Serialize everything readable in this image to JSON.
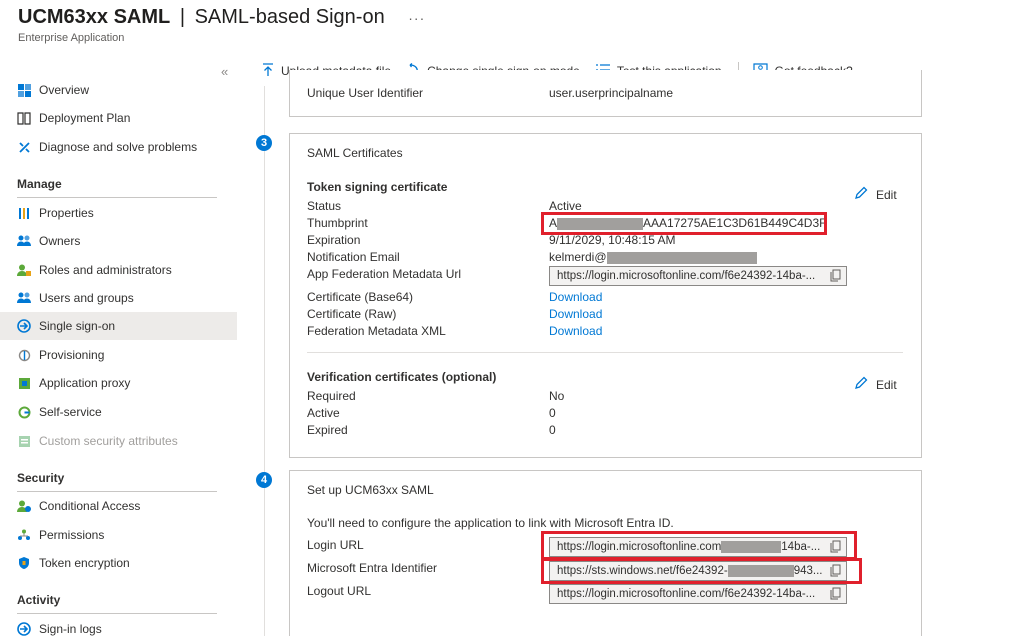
{
  "header": {
    "title_bold": "UCM63xx SAML",
    "title_sep": "|",
    "title_rest": "SAML-based Sign-on",
    "more": "···",
    "subtitle": "Enterprise Application"
  },
  "sidebar": {
    "collapse": "«",
    "items_top": [
      {
        "label": "Overview"
      },
      {
        "label": "Deployment Plan"
      },
      {
        "label": "Diagnose and solve problems"
      }
    ],
    "manage_header": "Manage",
    "manage": [
      {
        "label": "Properties"
      },
      {
        "label": "Owners"
      },
      {
        "label": "Roles and administrators"
      },
      {
        "label": "Users and groups"
      },
      {
        "label": "Single sign-on"
      },
      {
        "label": "Provisioning"
      },
      {
        "label": "Application proxy"
      },
      {
        "label": "Self-service"
      },
      {
        "label": "Custom security attributes"
      }
    ],
    "security_header": "Security",
    "security": [
      {
        "label": "Conditional Access"
      },
      {
        "label": "Permissions"
      },
      {
        "label": "Token encryption"
      }
    ],
    "activity_header": "Activity",
    "activity": [
      {
        "label": "Sign-in logs"
      }
    ]
  },
  "toolbar": {
    "upload": "Upload metadata file",
    "change_mode": "Change single sign-on mode",
    "test": "Test this application",
    "feedback": "Got feedback?"
  },
  "card2": {
    "label": "Unique User Identifier",
    "value": "user.userprincipalname"
  },
  "card3": {
    "step": "3",
    "title": "SAML Certificates",
    "token_header": "Token signing certificate",
    "edit": "Edit",
    "status_label": "Status",
    "status_value": "Active",
    "thumbprint_label": "Thumbprint",
    "thumbprint_prefix": "A",
    "thumbprint_suffix": "AAA17275AE1C3D61B449C4D3F",
    "expiration_label": "Expiration",
    "expiration_value": "9/11/2029, 10:48:15 AM",
    "email_label": "Notification Email",
    "email_value": "kelmerdi@",
    "metadata_url_label": "App Federation Metadata Url",
    "metadata_url_value": "https://login.microsoftonline.com/f6e24392-14ba-...",
    "cert_base64_label": "Certificate (Base64)",
    "cert_raw_label": "Certificate (Raw)",
    "fed_xml_label": "Federation Metadata XML",
    "download": "Download",
    "verif_header": "Verification certificates (optional)",
    "verif_edit": "Edit",
    "required_label": "Required",
    "required_value": "No",
    "active_label": "Active",
    "active_value": "0",
    "expired_label": "Expired",
    "expired_value": "0"
  },
  "card4": {
    "step": "4",
    "title": "Set up UCM63xx SAML",
    "intro": "You'll need to configure the application to link with Microsoft Entra ID.",
    "login_label": "Login URL",
    "login_prefix": "https://login.microsoftonline.com",
    "login_suffix": "14ba-...",
    "entra_label": "Microsoft Entra Identifier",
    "entra_prefix": "https://sts.windows.net/f6e24392-",
    "entra_suffix": "943...",
    "logout_label": "Logout URL",
    "logout_value": "https://login.microsoftonline.com/f6e24392-14ba-..."
  },
  "colors": {
    "accent": "#0078d4",
    "highlight": "#e0202c"
  }
}
